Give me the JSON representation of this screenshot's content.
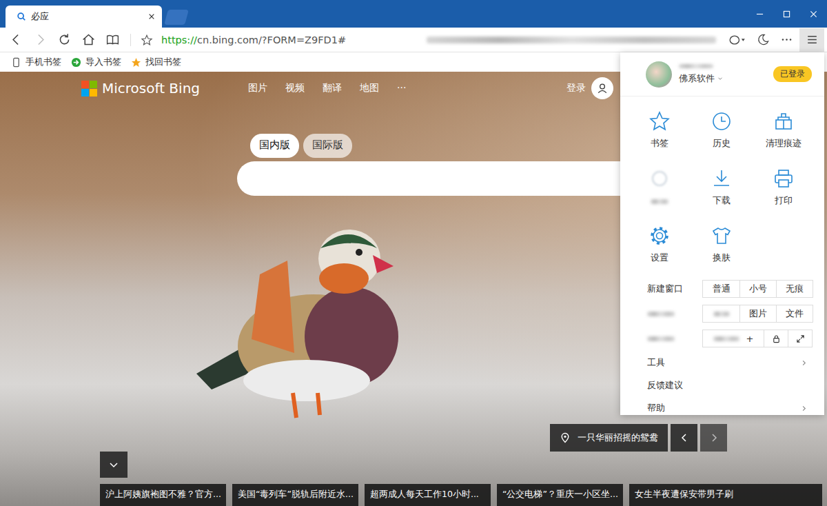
{
  "window": {
    "tabs": [
      {
        "label": "必应",
        "selected": true
      }
    ]
  },
  "toolbar": {
    "url_scheme": "https://",
    "url_rest": "cn.bing.com/?FORM=Z9FD1#",
    "forward_disabled": true,
    "menu_open": true,
    "blurred_text": true
  },
  "bookmarks": [
    {
      "label": "手机书签"
    },
    {
      "label": "导入书签"
    },
    {
      "label": "找回书签"
    }
  ],
  "page": {
    "logo": "Microsoft Bing",
    "nav": [
      "图片",
      "视频",
      "翻译",
      "地图",
      "···"
    ],
    "login": "登录",
    "region_tabs": [
      {
        "label": "国内版",
        "selected": true
      },
      {
        "label": "国际版",
        "selected": false
      }
    ],
    "caption": "一只华丽招摇的鸳鸯",
    "news": [
      "沪上阿姨旗袍图不雅？官方...",
      "美国“毒列车”脱轨后附近水...",
      "超两成人每天工作10小时...",
      "“公交电梯”？重庆一小区坐...",
      "女生半夜遭保安带男子刷"
    ]
  },
  "menu": {
    "user": {
      "name": "佛系软件",
      "status": "已登录",
      "blurred_nickname": true
    },
    "tiles": [
      {
        "label": "书签",
        "blurred": false
      },
      {
        "label": "历史",
        "blurred": false
      },
      {
        "label": "清理痕迹",
        "blurred": false
      },
      {
        "label": "",
        "blurred": true
      },
      {
        "label": "下载",
        "blurred": false
      },
      {
        "label": "打印",
        "blurred": false
      },
      {
        "label": "设置",
        "blurred": false
      },
      {
        "label": "换肤",
        "blurred": false
      }
    ],
    "rows": [
      {
        "label": "新建窗口",
        "blurred": false,
        "cells": [
          {
            "kind": "text",
            "text": "普通",
            "blurred": false
          },
          {
            "kind": "text",
            "text": "小号",
            "blurred": false
          },
          {
            "kind": "text",
            "text": "无痕",
            "blurred": false
          }
        ]
      },
      {
        "label": "",
        "blurred": true,
        "cells": [
          {
            "kind": "text",
            "text": "",
            "blurred": true
          },
          {
            "kind": "text",
            "text": "图片",
            "blurred": false
          },
          {
            "kind": "text",
            "text": "文件",
            "blurred": false
          }
        ]
      },
      {
        "label": "",
        "blurred": true,
        "cells": [
          {
            "kind": "zoom",
            "text": "+",
            "blurred": true
          },
          {
            "kind": "icon"
          },
          {
            "kind": "icon"
          }
        ]
      }
    ],
    "links": [
      {
        "label": "工具",
        "submenu": true
      },
      {
        "label": "反馈建议",
        "submenu": false
      },
      {
        "label": "帮助",
        "submenu": true
      }
    ]
  }
}
